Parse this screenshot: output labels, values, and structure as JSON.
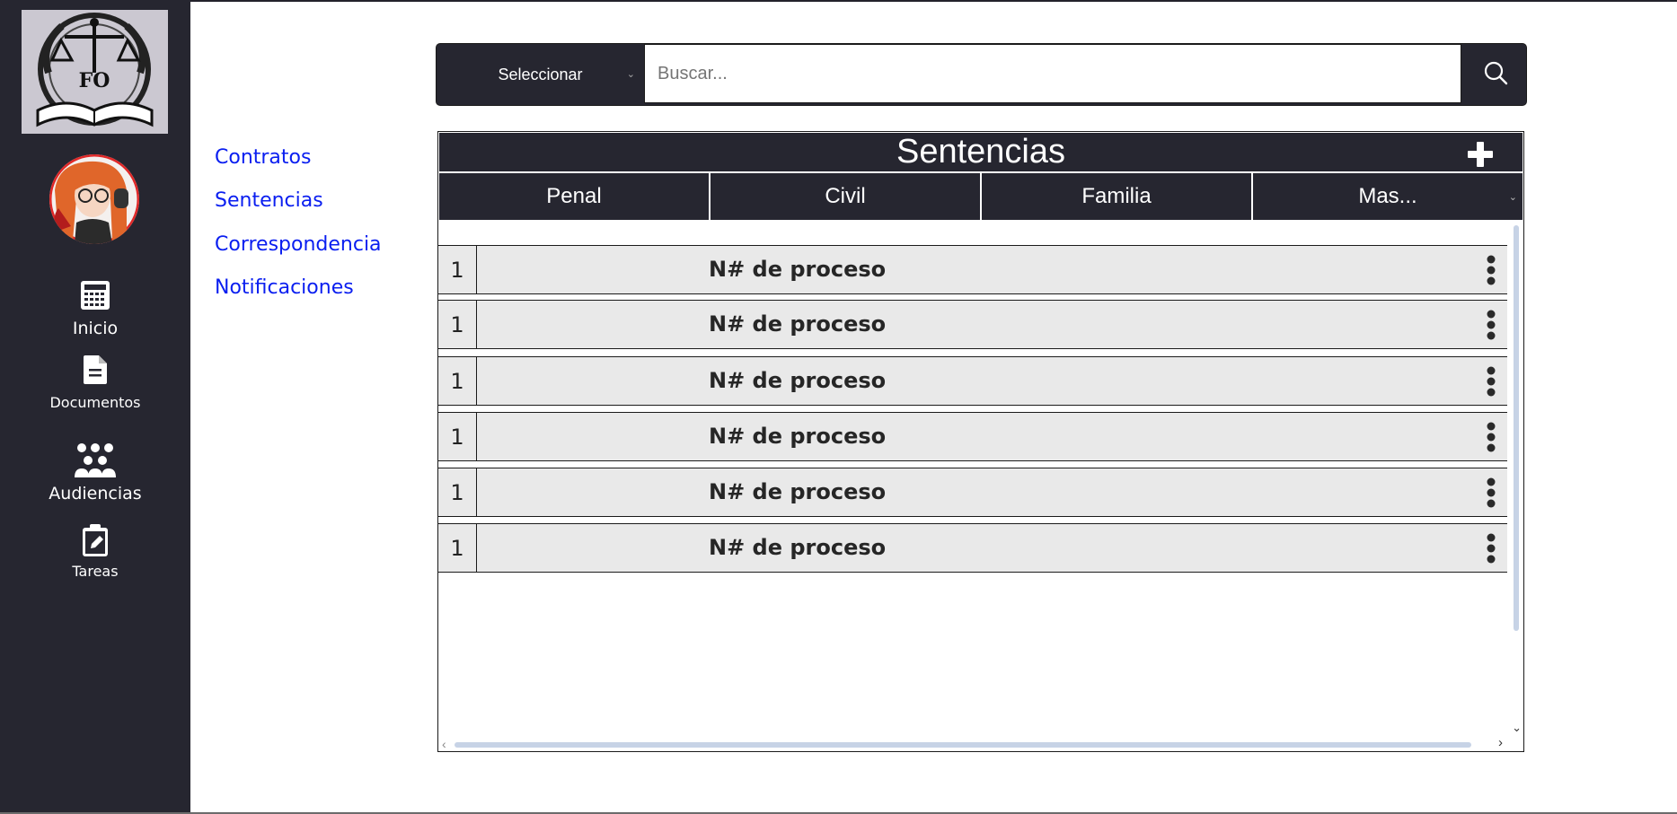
{
  "sidebar": {
    "nav": [
      {
        "label": "Inicio",
        "icon": "calculator-icon"
      },
      {
        "label": "Documentos",
        "icon": "document-icon"
      },
      {
        "label": "Audiencias",
        "icon": "people-group-icon"
      },
      {
        "label": "Tareas",
        "icon": "clipboard-pencil-icon"
      }
    ]
  },
  "links": [
    "Contratos",
    "Sentencias",
    "Correspondencia",
    "Notificaciones"
  ],
  "search": {
    "select_label": "Seleccionar",
    "placeholder": "Buscar...",
    "button_icon": "search-icon"
  },
  "panel": {
    "title": "Sentencias",
    "add_icon": "plus-icon",
    "tabs": [
      "Penal",
      "Civil",
      "Familia",
      "Mas..."
    ],
    "rows": [
      {
        "num": "1",
        "label": "N# de proceso"
      },
      {
        "num": "1",
        "label": "N# de proceso"
      },
      {
        "num": "1",
        "label": "N# de proceso"
      },
      {
        "num": "1",
        "label": "N# de proceso"
      },
      {
        "num": "1",
        "label": "N# de proceso"
      },
      {
        "num": "1",
        "label": "N# de proceso"
      }
    ]
  },
  "colors": {
    "sidebar_bg": "#262630",
    "link": "#0a1ef0",
    "row_bg": "#e9e9e9"
  }
}
